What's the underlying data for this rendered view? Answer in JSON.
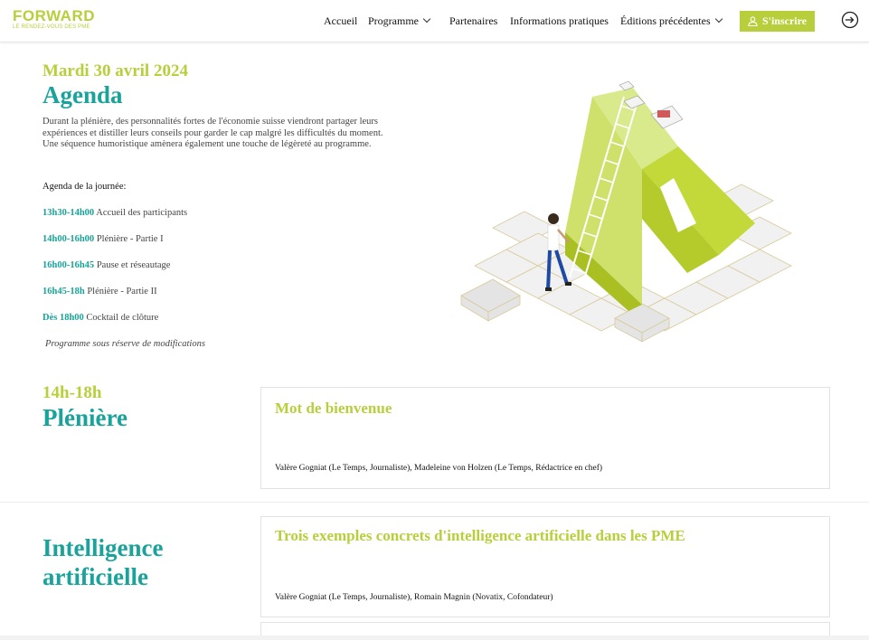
{
  "header": {
    "logo_word": "FORWARD",
    "logo_tagline": "LE RENDEZ-VOUS DES PME",
    "nav": [
      {
        "label": "Accueil",
        "dropdown": false
      },
      {
        "label": "Programme",
        "dropdown": true
      },
      {
        "label": "Partenaires",
        "dropdown": false
      },
      {
        "label": "Informations pratiques",
        "dropdown": false
      },
      {
        "label": "Éditions précédentes",
        "dropdown": true
      }
    ],
    "signup_label": "S'inscrire",
    "login_icon": "sign-in-icon"
  },
  "intro": {
    "date": "Mardi 30 avril 2024",
    "title": "Agenda",
    "description": "Durant la plénière, des personnalités fortes de l'économie suisse viendront partager leurs expériences et distiller leurs conseils pour garder le cap malgré les difficultés du moment. Une séquence humoristique amènera également une touche de légèreté au programme.",
    "agenda_heading": "Agenda de la journée:",
    "schedule": [
      {
        "time": "13h30-14h00",
        "label": "Accueil des participants"
      },
      {
        "time": "14h00-16h00",
        "label": "Plénière - Partie I"
      },
      {
        "time": "16h00-16h45",
        "label": "Pause et réseautage"
      },
      {
        "time": "16h45-18h",
        "label": "Plénière - Partie II"
      },
      {
        "time": "Dès 18h00",
        "label": "Cocktail de clôture"
      }
    ],
    "note": "Programme sous réserve de modifications"
  },
  "sections": [
    {
      "time": "14h-18h",
      "title": "Plénière",
      "card": {
        "title": "Mot de bienvenue",
        "speakers": "Valère Gogniat (Le Temps, Journaliste), Madeleine von Holzen (Le Temps, Rédactrice en chef)"
      }
    },
    {
      "time": "",
      "title": "Intelligence artificielle",
      "card": {
        "title": "Trois exemples concrets d'intelligence artificielle dans les PME",
        "speakers": "Valère Gogniat (Le Temps, Journaliste), Romain Magnin (Novatix, Cofondateur)"
      }
    }
  ],
  "colors": {
    "accent_green": "#b8cf3b",
    "accent_teal": "#1aa39a"
  }
}
